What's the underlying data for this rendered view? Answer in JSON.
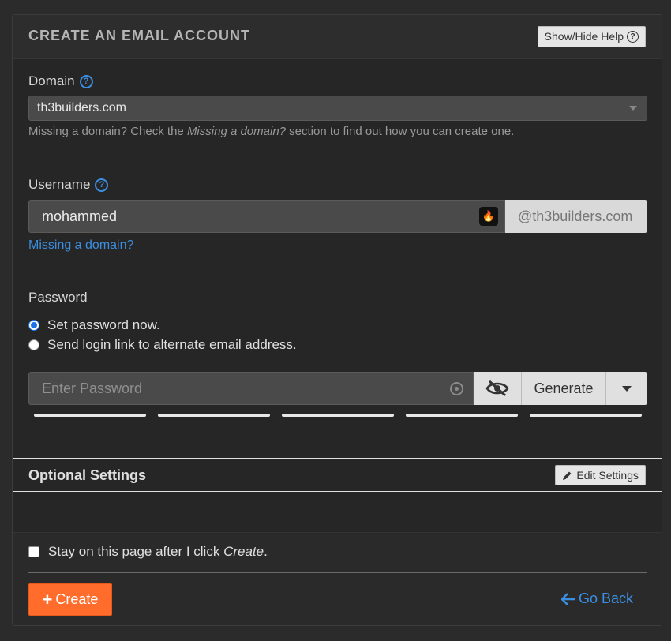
{
  "header": {
    "title": "CREATE AN EMAIL ACCOUNT",
    "help_button": "Show/Hide Help",
    "help_icon": "?"
  },
  "domain": {
    "label": "Domain",
    "selected": "th3builders.com",
    "help_prefix": "Missing a domain? Check the ",
    "help_em": "Missing a domain?",
    "help_suffix": " section to find out how you can create one."
  },
  "username": {
    "label": "Username",
    "value": "mohammed",
    "suffix": "@th3builders.com",
    "missing_link": "Missing a domain?"
  },
  "password": {
    "label": "Password",
    "option_set_now": "Set password now.",
    "option_send_link": "Send login link to alternate email address.",
    "placeholder": "Enter Password",
    "generate_label": "Generate",
    "strength_segments": 5
  },
  "optional": {
    "title": "Optional Settings",
    "edit_button": "Edit Settings"
  },
  "footer": {
    "stay_prefix": "Stay on this page after I click ",
    "stay_em": "Create",
    "stay_suffix": ".",
    "create_label": "Create",
    "back_label": "Go Back"
  },
  "colors": {
    "accent_blue": "#3b8ee0",
    "create_orange": "#ff6c2c"
  }
}
